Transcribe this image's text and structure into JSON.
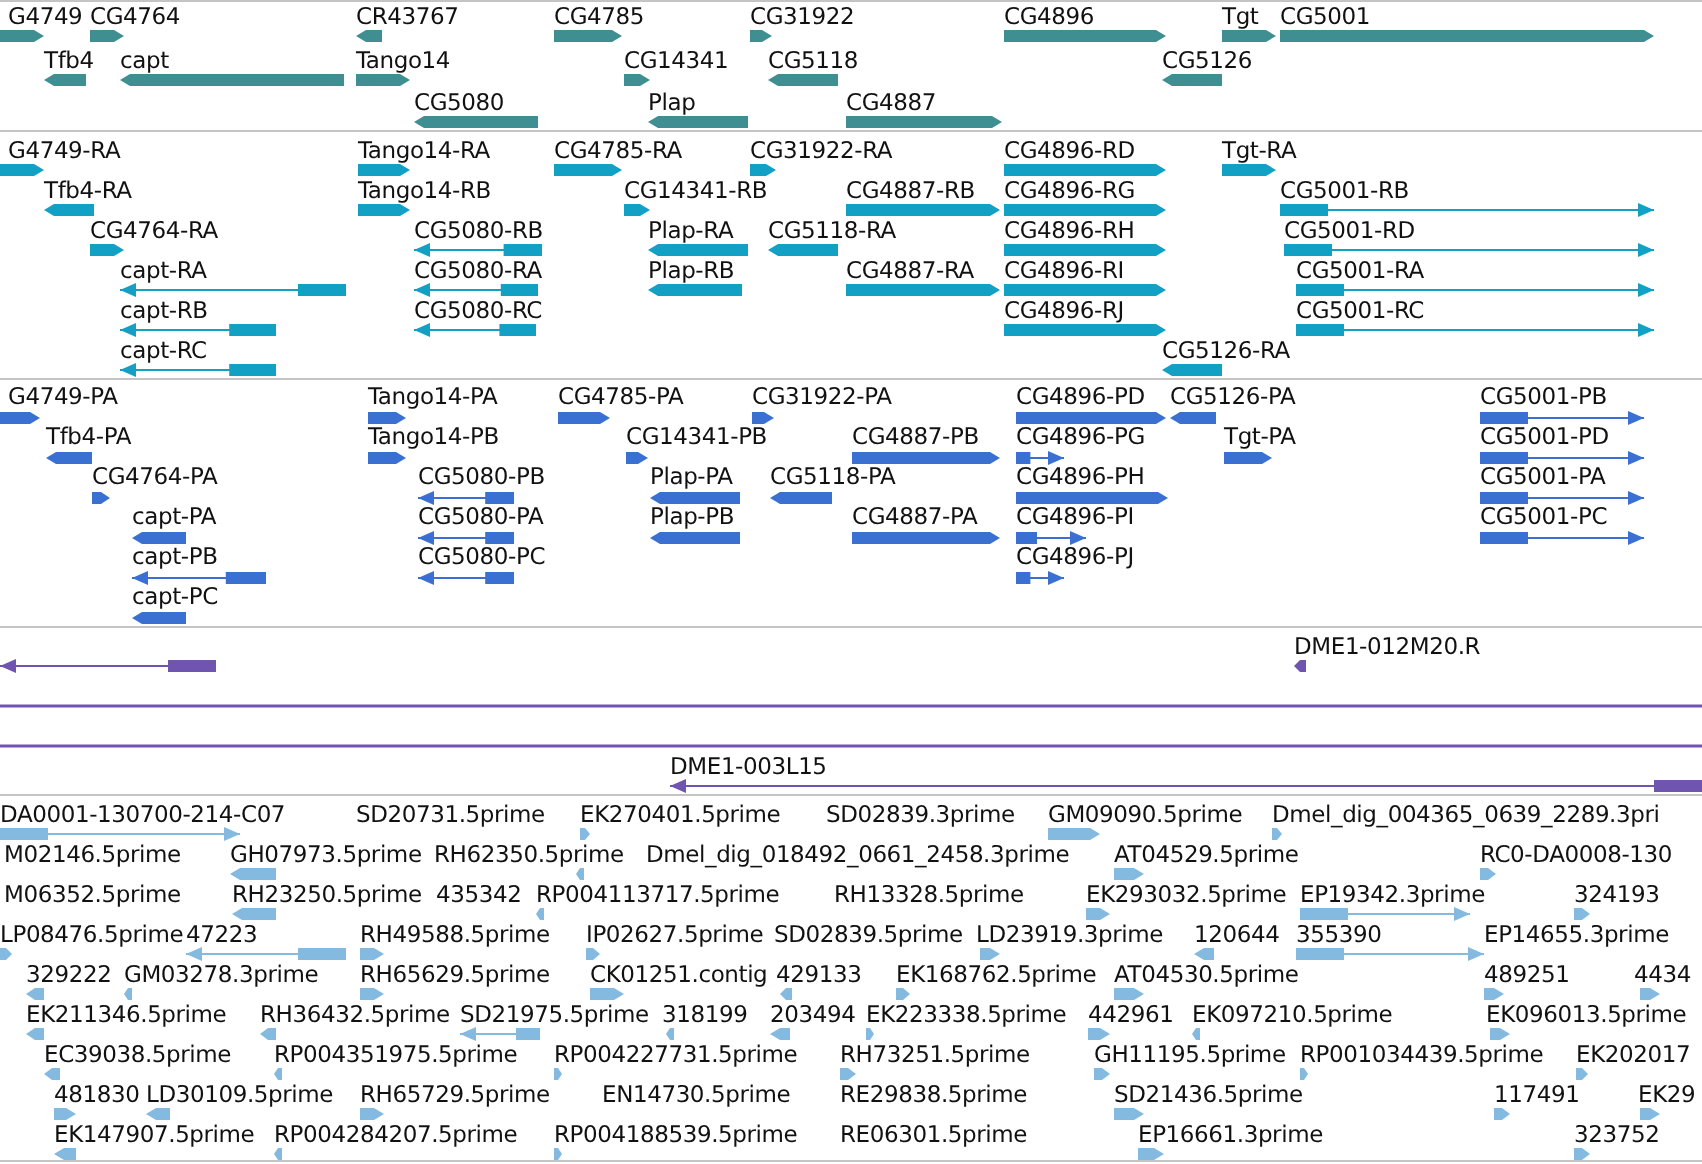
{
  "tracks": [
    {
      "kind": "genes",
      "features": [
        {
          "name": "G4749",
          "reverse": false
        },
        {
          "name": "CG4764",
          "reverse": false
        },
        {
          "name": "CR43767",
          "reverse": true
        },
        {
          "name": "CG4785",
          "reverse": false
        },
        {
          "name": "CG31922",
          "reverse": false
        },
        {
          "name": "CG4896",
          "reverse": false
        },
        {
          "name": "Tgt",
          "reverse": false
        },
        {
          "name": "CG5001",
          "reverse": false
        },
        {
          "name": "Tfb4",
          "reverse": true
        },
        {
          "name": "capt",
          "reverse": true
        },
        {
          "name": "Tango14",
          "reverse": false
        },
        {
          "name": "CG14341",
          "reverse": false
        },
        {
          "name": "CG5118",
          "reverse": true
        },
        {
          "name": "CG5126",
          "reverse": true
        },
        {
          "name": "CG5080",
          "reverse": true
        },
        {
          "name": "Plap",
          "reverse": true
        },
        {
          "name": "CG4887",
          "reverse": false
        }
      ]
    },
    {
      "kind": "transcripts",
      "features": [
        {
          "name": "G4749-RA",
          "reverse": false
        },
        {
          "name": "Tango14-RA",
          "reverse": false
        },
        {
          "name": "CG4785-RA",
          "reverse": false
        },
        {
          "name": "CG31922-RA",
          "reverse": false
        },
        {
          "name": "CG4896-RD",
          "reverse": false
        },
        {
          "name": "Tgt-RA",
          "reverse": false
        },
        {
          "name": "Tfb4-RA",
          "reverse": true
        },
        {
          "name": "Tango14-RB",
          "reverse": false
        },
        {
          "name": "CG14341-RB",
          "reverse": false
        },
        {
          "name": "CG4887-RB",
          "reverse": false
        },
        {
          "name": "CG4896-RG",
          "reverse": false
        },
        {
          "name": "CG5001-RB",
          "reverse": false
        },
        {
          "name": "CG4764-RA",
          "reverse": false
        },
        {
          "name": "CG5080-RB",
          "reverse": true
        },
        {
          "name": "Plap-RA",
          "reverse": true
        },
        {
          "name": "CG5118-RA",
          "reverse": true
        },
        {
          "name": "CG4896-RH",
          "reverse": false
        },
        {
          "name": "CG5001-RD",
          "reverse": false
        },
        {
          "name": "capt-RA",
          "reverse": true
        },
        {
          "name": "CG5080-RA",
          "reverse": true
        },
        {
          "name": "Plap-RB",
          "reverse": true
        },
        {
          "name": "CG4887-RA",
          "reverse": false
        },
        {
          "name": "CG4896-RI",
          "reverse": false
        },
        {
          "name": "CG5001-RA",
          "reverse": false
        },
        {
          "name": "capt-RB",
          "reverse": true
        },
        {
          "name": "CG5080-RC",
          "reverse": true
        },
        {
          "name": "CG4896-RJ",
          "reverse": false
        },
        {
          "name": "CG5001-RC",
          "reverse": false
        },
        {
          "name": "capt-RC",
          "reverse": true
        },
        {
          "name": "CG5126-RA",
          "reverse": true
        }
      ]
    },
    {
      "kind": "proteins",
      "features": [
        {
          "name": "G4749-PA",
          "reverse": false
        },
        {
          "name": "Tango14-PA",
          "reverse": false
        },
        {
          "name": "CG4785-PA",
          "reverse": false
        },
        {
          "name": "CG31922-PA",
          "reverse": false
        },
        {
          "name": "CG4896-PD",
          "reverse": false
        },
        {
          "name": "CG5126-PA",
          "reverse": true
        },
        {
          "name": "CG5001-PB",
          "reverse": false
        },
        {
          "name": "Tfb4-PA",
          "reverse": true
        },
        {
          "name": "Tango14-PB",
          "reverse": false
        },
        {
          "name": "CG14341-PB",
          "reverse": false
        },
        {
          "name": "CG4887-PB",
          "reverse": false
        },
        {
          "name": "CG4896-PG",
          "reverse": false
        },
        {
          "name": "Tgt-PA",
          "reverse": false
        },
        {
          "name": "CG5001-PD",
          "reverse": false
        },
        {
          "name": "CG4764-PA",
          "reverse": false
        },
        {
          "name": "CG5080-PB",
          "reverse": true
        },
        {
          "name": "Plap-PA",
          "reverse": true
        },
        {
          "name": "CG5118-PA",
          "reverse": true
        },
        {
          "name": "CG4896-PH",
          "reverse": false
        },
        {
          "name": "CG5001-PA",
          "reverse": false
        },
        {
          "name": "capt-PA",
          "reverse": true
        },
        {
          "name": "CG5080-PA",
          "reverse": true
        },
        {
          "name": "Plap-PB",
          "reverse": true
        },
        {
          "name": "CG4887-PA",
          "reverse": false
        },
        {
          "name": "CG4896-PI",
          "reverse": false
        },
        {
          "name": "CG5001-PC",
          "reverse": false
        },
        {
          "name": "capt-PB",
          "reverse": true
        },
        {
          "name": "CG5080-PC",
          "reverse": true
        },
        {
          "name": "CG4896-PJ",
          "reverse": false
        },
        {
          "name": "capt-PC",
          "reverse": true
        }
      ]
    },
    {
      "kind": "clones",
      "features": [
        {
          "kind": "clone",
          "reverse": true
        },
        {
          "kind": "clone",
          "name": "DME1-012M20.R",
          "reverse": true
        },
        {
          "kind": "span"
        },
        {
          "kind": "span"
        },
        {
          "kind": "clone",
          "name": "DME1-003L15",
          "reverse": true
        }
      ]
    },
    {
      "kind": "ests",
      "features": [
        {
          "name": "DA0001-130700-214-C07",
          "reverse": false
        },
        {
          "name": "SD20731.5prime"
        },
        {
          "name": "EK270401.5prime",
          "reverse": false
        },
        {
          "name": "SD02839.3prime"
        },
        {
          "name": "GM09090.5prime",
          "reverse": false
        },
        {
          "name": "Dmel_dig_004365_0639_2289.3pri",
          "reverse": false
        },
        {
          "name": "M02146.5prime"
        },
        {
          "name": "GH07973.5prime",
          "reverse": true
        },
        {
          "name": "RH62350.5prime",
          "reverse": true
        },
        {
          "name": "Dmel_dig_018492_0661_2458.3prime"
        },
        {
          "name": "AT04529.5prime",
          "reverse": false
        },
        {
          "name": "RC0-DA0008-130",
          "reverse": false
        },
        {
          "name": "M06352.5prime"
        },
        {
          "name": "RH23250.5prime",
          "reverse": true
        },
        {
          "name": "435342"
        },
        {
          "name": "RP004113717.5prime",
          "reverse": true
        },
        {
          "name": "RH13328.5prime"
        },
        {
          "name": "EK293032.5prime",
          "reverse": false
        },
        {
          "name": "EP19342.3prime",
          "reverse": false
        },
        {
          "name": "324193",
          "reverse": false
        },
        {
          "name": "LP08476.5prime",
          "reverse": false
        },
        {
          "name": "47223",
          "reverse": true
        },
        {
          "name": "RH49588.5prime",
          "reverse": false
        },
        {
          "name": "IP02627.5prime",
          "reverse": false
        },
        {
          "name": "SD02839.5prime"
        },
        {
          "name": "LD23919.3prime",
          "reverse": false
        },
        {
          "name": "120644",
          "reverse": true
        },
        {
          "name": "355390",
          "reverse": false
        },
        {
          "name": "EP14655.3prime"
        },
        {
          "name": "329222",
          "reverse": true
        },
        {
          "name": "GM03278.3prime",
          "reverse": true
        },
        {
          "name": "RH65629.5prime",
          "reverse": false
        },
        {
          "name": "CK01251.contig",
          "reverse": false
        },
        {
          "name": "429133",
          "reverse": true
        },
        {
          "name": "EK168762.5prime",
          "reverse": false
        },
        {
          "name": "AT04530.5prime",
          "reverse": false
        },
        {
          "name": "489251",
          "reverse": false
        },
        {
          "name": "4434",
          "reverse": false
        },
        {
          "name": "EK211346.5prime",
          "reverse": true
        },
        {
          "name": "RH36432.5prime",
          "reverse": true
        },
        {
          "name": "SD21975.5prime",
          "reverse": true
        },
        {
          "name": "318199",
          "reverse": true
        },
        {
          "name": "203494",
          "reverse": true
        },
        {
          "name": "EK223338.5prime",
          "reverse": false
        },
        {
          "name": "442961",
          "reverse": false
        },
        {
          "name": "EK097210.5prime",
          "reverse": true
        },
        {
          "name": "EK096013.5prime",
          "reverse": false
        },
        {
          "name": "EC39038.5prime",
          "reverse": true
        },
        {
          "name": "RP004351975.5prime",
          "reverse": true
        },
        {
          "name": "RP004227731.5prime",
          "reverse": false
        },
        {
          "name": "RH73251.5prime",
          "reverse": false
        },
        {
          "name": "GH11195.5prime",
          "reverse": false
        },
        {
          "name": "RP001034439.5prime",
          "reverse": false
        },
        {
          "name": "EK202017",
          "reverse": false
        },
        {
          "name": "481830",
          "reverse": false
        },
        {
          "name": "LD30109.5prime",
          "reverse": true
        },
        {
          "name": "RH65729.5prime",
          "reverse": false
        },
        {
          "name": "EN14730.5prime"
        },
        {
          "name": "RE29838.5prime"
        },
        {
          "name": "SD21436.5prime",
          "reverse": false
        },
        {
          "name": "117491",
          "reverse": false
        },
        {
          "name": "EK29",
          "reverse": false
        },
        {
          "name": "EK147907.5prime",
          "reverse": true
        },
        {
          "name": "RP004284207.5prime",
          "reverse": true
        },
        {
          "name": "RP004188539.5prime",
          "reverse": false
        },
        {
          "name": "RE06301.5prime"
        },
        {
          "name": "EP16661.3prime",
          "reverse": false
        },
        {
          "name": "323752",
          "reverse": false
        }
      ]
    }
  ]
}
